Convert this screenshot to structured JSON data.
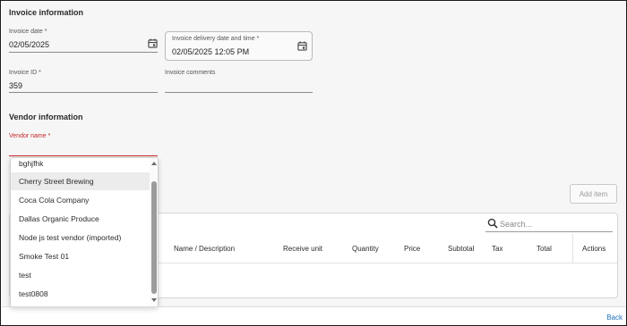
{
  "invoice_section": {
    "title": "Invoice information",
    "invoice_date": {
      "label": "Invoice date *",
      "value": "02/05/2025"
    },
    "delivery_date": {
      "label": "Invoice delivery date and time *",
      "value": "02/05/2025 12:05 PM"
    },
    "invoice_id": {
      "label": "Invoice ID *",
      "value": "359"
    },
    "invoice_comments": {
      "label": "Invoice comments",
      "value": ""
    }
  },
  "vendor_section": {
    "title": "Vendor information",
    "vendor_name": {
      "label": "Vendor name *",
      "value": ""
    }
  },
  "vendor_dropdown": {
    "options": [
      "bghjfhk",
      "Cherry Street Brewing",
      "Coca Cola Company",
      "Dallas Organic Produce",
      "Node js test vendor (imported)",
      "Smoke Test 01",
      "test",
      "test0808"
    ],
    "hovered": "Cherry Street Brewing"
  },
  "items": {
    "add_item_label": "Add item",
    "search_placeholder": "Search...",
    "columns": [
      "Name / Description",
      "Receive unit",
      "Quantity",
      "Price",
      "Subtotal",
      "Tax",
      "Total",
      "Actions"
    ]
  },
  "footer": {
    "back_label": "Back"
  },
  "colors": {
    "error": "#c62828",
    "link": "#1f6fb8",
    "panel_bg": "#f6f6f6"
  },
  "icons": [
    "calendar-icon",
    "search-icon",
    "scroll-up-arrow-icon",
    "scroll-down-arrow-icon"
  ]
}
